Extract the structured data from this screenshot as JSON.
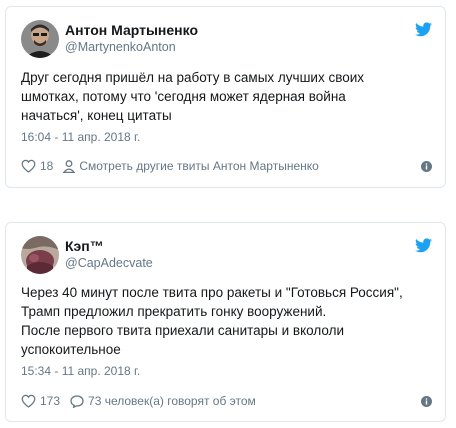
{
  "tweets": [
    {
      "name": "Антон Мартыненко",
      "handle": "@MartynenkoAnton",
      "text_lines": [
        "Друг сегодня пришёл на работу в самых лучших своих",
        "шмотках, потому что 'сегодня может ядерная война",
        "начаться', конец цитаты"
      ],
      "time": "16:04 - 11 апр. 2018 г.",
      "likes": "18",
      "people_text": "Смотреть другие твиты Антон Мартыненко",
      "avatar_icon": "user-avatar-photo",
      "people_icon": "person-icon"
    },
    {
      "name": "Кэп™",
      "handle": "@CapAdecvate",
      "text_lines": [
        "Через 40 минут после твита про ракеты и \"Готовься Россия\",",
        "Трамп предложил прекратить гонку вооружений.",
        "После первого твита приехали санитары и вкололи",
        "успокоительное"
      ],
      "time": "15:34 - 11 апр. 2018 г.",
      "likes": "173",
      "people_text": "73 человек(а) говорят об этом",
      "avatar_icon": "user-avatar-photo",
      "people_icon": "comment-bubble-icon"
    }
  ],
  "colors": {
    "text": "#14171a",
    "secondary": "#657786",
    "twitter_blue": "#1da1f2",
    "border": "#e1e8ed"
  }
}
